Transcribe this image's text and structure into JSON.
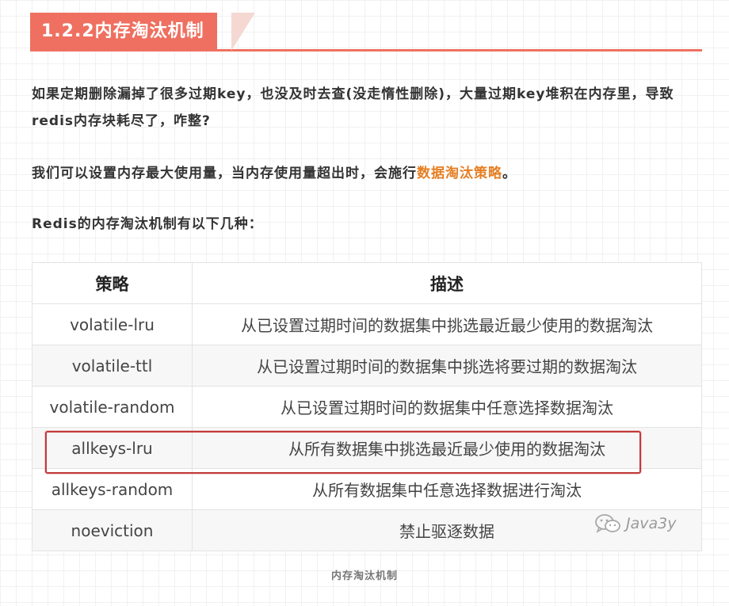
{
  "heading": {
    "title": "1.2.2内存淘汰机制"
  },
  "paragraphs": {
    "p1": "如果定期删除漏掉了很多过期key，也没及时去查(没走惰性删除)，大量过期key堆积在内存里，导致redis内存块耗尽了，咋整?",
    "p2_prefix": "我们可以设置内存最大使用量，当内存使用量超出时，会施行",
    "p2_highlight": "数据淘汰策略",
    "p2_suffix": "。",
    "p3": "Redis的内存淘汰机制有以下几种："
  },
  "table": {
    "headers": [
      "策略",
      "描述"
    ],
    "rows": [
      {
        "strategy": "volatile-lru",
        "description": "从已设置过期时间的数据集中挑选最近最少使用的数据淘汰"
      },
      {
        "strategy": "volatile-ttl",
        "description": "从已设置过期时间的数据集中挑选将要过期的数据淘汰"
      },
      {
        "strategy": "volatile-random",
        "description": "从已设置过期时间的数据集中任意选择数据淘汰"
      },
      {
        "strategy": "allkeys-lru",
        "description": "从所有数据集中挑选最近最少使用的数据淘汰"
      },
      {
        "strategy": "allkeys-random",
        "description": "从所有数据集中任意选择数据进行淘汰"
      },
      {
        "strategy": "noeviction",
        "description": "禁止驱逐数据"
      }
    ],
    "highlighted_row": 3
  },
  "watermark": {
    "icon": "wechat-icon",
    "text": "Java3y"
  },
  "caption": "内存淘汰机制",
  "colors": {
    "heading_bg": "#ef7060",
    "accent_text": "#e67e22",
    "highlight_border": "#c23a3a"
  }
}
